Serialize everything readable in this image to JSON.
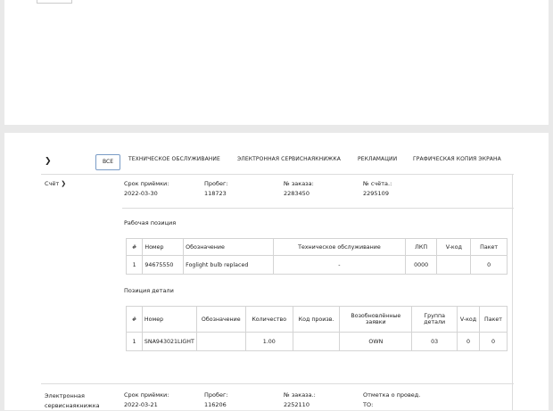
{
  "tabs": {
    "all": "ВСЕ",
    "maintenance": "ТЕХНИЧЕСКОЕ ОБСЛУЖИВАНИЕ",
    "service_book": "ЭЛЕКТРОННАЯ СЕРВИСНАЯКНИЖКА",
    "claims": "РЕКЛАМАЦИИ",
    "screen_copy": "ГРАФИЧЕСКАЯ КОПИЯ ЭКРАНА"
  },
  "record1": {
    "type": "Счёт",
    "date_label": "Срок приёмки:",
    "date_value": "2022-03-30",
    "mileage_label": "Пробег:",
    "mileage_value": "118723",
    "order_label": "№ заказа:",
    "order_value": "2283450",
    "invoice_label": "№ счёта.:",
    "invoice_value": "2295109",
    "work_title": "Рабочая позиция",
    "work_headers": [
      "#",
      "Номер",
      "Обозначение",
      "Техническое обслуживание",
      "ЛКП",
      "V-код",
      "Пакет"
    ],
    "work_rows": [
      [
        "1",
        "94675550",
        "Foglight bulb replaced",
        "-",
        "0000",
        "",
        "0"
      ]
    ],
    "parts_title": "Позиция детали",
    "parts_headers": [
      "#",
      "Номер",
      "Обозначение",
      "Количество",
      "Код произв.",
      "Возобновлённые заявки",
      "Группа детали",
      "V-код",
      "Пакет"
    ],
    "parts_rows": [
      [
        "1",
        "SNA943021LIGHT",
        "",
        "1.00",
        "",
        "OWN",
        "03",
        "0",
        "0"
      ]
    ]
  },
  "record2": {
    "type": "Электронная сервиснаякнижка",
    "date_label": "Срок приёмки:",
    "date_value": "2022-03-21",
    "mileage_label": "Пробег:",
    "mileage_value": "116206",
    "order_label": "№ заказа.:",
    "order_value": "2252110",
    "mark_label": "Отметка о провед.",
    "mark_value": "ТО:"
  }
}
